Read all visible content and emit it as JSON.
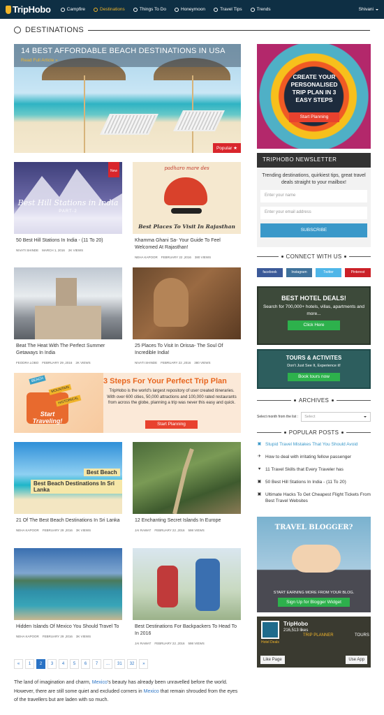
{
  "header": {
    "logo": "TripHobo",
    "nav": [
      {
        "label": "Campfire",
        "icon": "campfire-icon",
        "active": false
      },
      {
        "label": "Destinations",
        "icon": "compass-icon",
        "active": true
      },
      {
        "label": "Things To Do",
        "icon": "run-icon",
        "active": false
      },
      {
        "label": "Honeymoon",
        "icon": "heart-icon",
        "active": false
      },
      {
        "label": "Travel Tips",
        "icon": "card-icon",
        "active": false
      },
      {
        "label": "Trends",
        "icon": "trend-icon",
        "active": false
      }
    ],
    "user": "Shivani"
  },
  "section_title": "DESTINATIONS",
  "hero": {
    "title": "14 BEST AFFORDABLE BEACH DESTINATIONS IN USA",
    "read_more": "Read Full Article »",
    "badge": "Popular ★"
  },
  "cards": [
    {
      "title": "50 Best Hill Stations In India - (11 To 20)",
      "author": "Nivati Shinde",
      "date": "March 1, 2016",
      "views": "2K Views",
      "img_text": "Best Hill Stations in India",
      "img_sub": "PART-2",
      "badge": "New"
    },
    {
      "title": "Khamma Ghani Sa- Your Guide To Feel Welcomed At Rajasthan!",
      "author": "Neha Kapoor",
      "date": "February 22 ,2016",
      "views": "380 Views",
      "img_text": "Best Places To Visit In Rajasthan",
      "img_sub": "padharo mare des"
    },
    {
      "title": "Beat The Heat With The Perfect Summer Getaways In India",
      "author": "Feodra Lobo",
      "date": "February 29 ,2016",
      "views": "2K Views"
    },
    {
      "title": "25 Places To Visit In Orissa- The Soul Of Incredible India!",
      "author": "Nivati Shinde",
      "date": "February 22 ,2016",
      "views": "380 Views"
    },
    {
      "title": "21 Of The Best Beach Destinations In Sri Lanka",
      "author": "Neha Kapoor",
      "date": "February 29 ,2016",
      "views": "3K Views",
      "img_text": "Best Beach Destinations In Sri Lanka"
    },
    {
      "title": "12 Enchanting Secret Islands In Europe",
      "author": "Jai Rawat",
      "date": "February 22 ,2016",
      "views": "598 Views"
    },
    {
      "title": "Hidden Islands Of Mexico You Should Travel To",
      "author": "Neha Kapoor",
      "date": "February 29 ,2016",
      "views": "3K Views"
    },
    {
      "title": "Best Destinations For Backpackers To Head To In 2016",
      "author": "Jai Rawat",
      "date": "February 22 ,2016",
      "views": "598 Views"
    }
  ],
  "promo": {
    "heading": "3 Steps For Your Perfect Trip Plan",
    "text": "TripHobo is the world's largest repository of user created itineraries. With over 600 cities, 50,000 attractions and 100,000 rated restaurants from across the globe, planning a trip was never this easy and quick.",
    "button": "Start Planning",
    "img_text": "Start Traveling!",
    "tags": [
      "BEACH",
      "MOUNTAIN",
      "HISTORICAL"
    ]
  },
  "pagination": [
    "«",
    "1",
    "2",
    "3",
    "4",
    "5",
    "6",
    "7",
    "...",
    "31",
    "32",
    "»"
  ],
  "pagination_current": "2",
  "intro": {
    "p1": "The land of imagination and charm, ",
    "link1": "Mexico",
    "p2": "'s beauty has already been unravelled before the world. However, there are still some quiet and excluded corners in ",
    "link2": "Mexico",
    "p3": " that remain shrouded from the eyes of the travellers but are laden with so much."
  },
  "sidebar": {
    "trip_ad": {
      "text": "CREATE YOUR PERSONALISED TRIP PLAN IN 3 EASY STEPS",
      "button": "Start Planning"
    },
    "newsletter": {
      "title": "TRIPHOBO NEWSLETTER",
      "desc": "Trending destinations, quirkiest tips, great travel deals straight to your mailbox!",
      "name_placeholder": "Enter your name",
      "email_placeholder": "Enter your email address",
      "button": "SUBSCRIBE"
    },
    "connect_title": "CONNECT WITH US",
    "social": [
      {
        "label": "facebook",
        "color": "#3b5998"
      },
      {
        "label": "Instagram",
        "color": "#3f729b"
      },
      {
        "label": "Twitter",
        "color": "#4fb6e8"
      },
      {
        "label": "Pinterest",
        "color": "#cb2027"
      }
    ],
    "hotel_ad": {
      "heading": "BEST HOTEL DEALS!",
      "text": "Search for 700,000+ hotels, villas, apartments and more...",
      "button": "Click Here"
    },
    "tours_ad": {
      "heading": "TOURS & ACTIVITES",
      "text": "Don't Just See It, Experience it!",
      "button": "Book tours now"
    },
    "archives": {
      "title": "ARCHIVES",
      "label": "Select month from the list :",
      "selected": "Select"
    },
    "popular": {
      "title": "POPULAR POSTS",
      "items": [
        {
          "label": "Stupid Travel Mistakes That You Should Avoid",
          "icon": "card-icon",
          "active": true
        },
        {
          "label": "How to deal with irritating fellow passenger",
          "icon": "run-icon",
          "active": false
        },
        {
          "label": "11 Travel Skills that Every Traveler has",
          "icon": "heart-icon",
          "active": false
        },
        {
          "label": "50 Best Hill Stations In India - (11 To 20)",
          "icon": "card-icon",
          "active": false
        },
        {
          "label": "Ultimate Hacks To Get Cheapest Flight Tickets From Best Travel Websites",
          "icon": "card-icon",
          "active": false
        }
      ]
    },
    "blogger_ad": {
      "heading": "TRAVEL BLOGGER?",
      "text": "START EARNING MORE FROM YOUR BLOG.",
      "button": "Sign Up for Blogger Widget"
    },
    "facebook": {
      "name": "TripHobo",
      "likes": "216,513 likes",
      "like_button": "Like Page",
      "app_button": "Use App",
      "labels": [
        "Hotel Deals",
        "TRIP PLANNER",
        "TOURS"
      ]
    }
  }
}
